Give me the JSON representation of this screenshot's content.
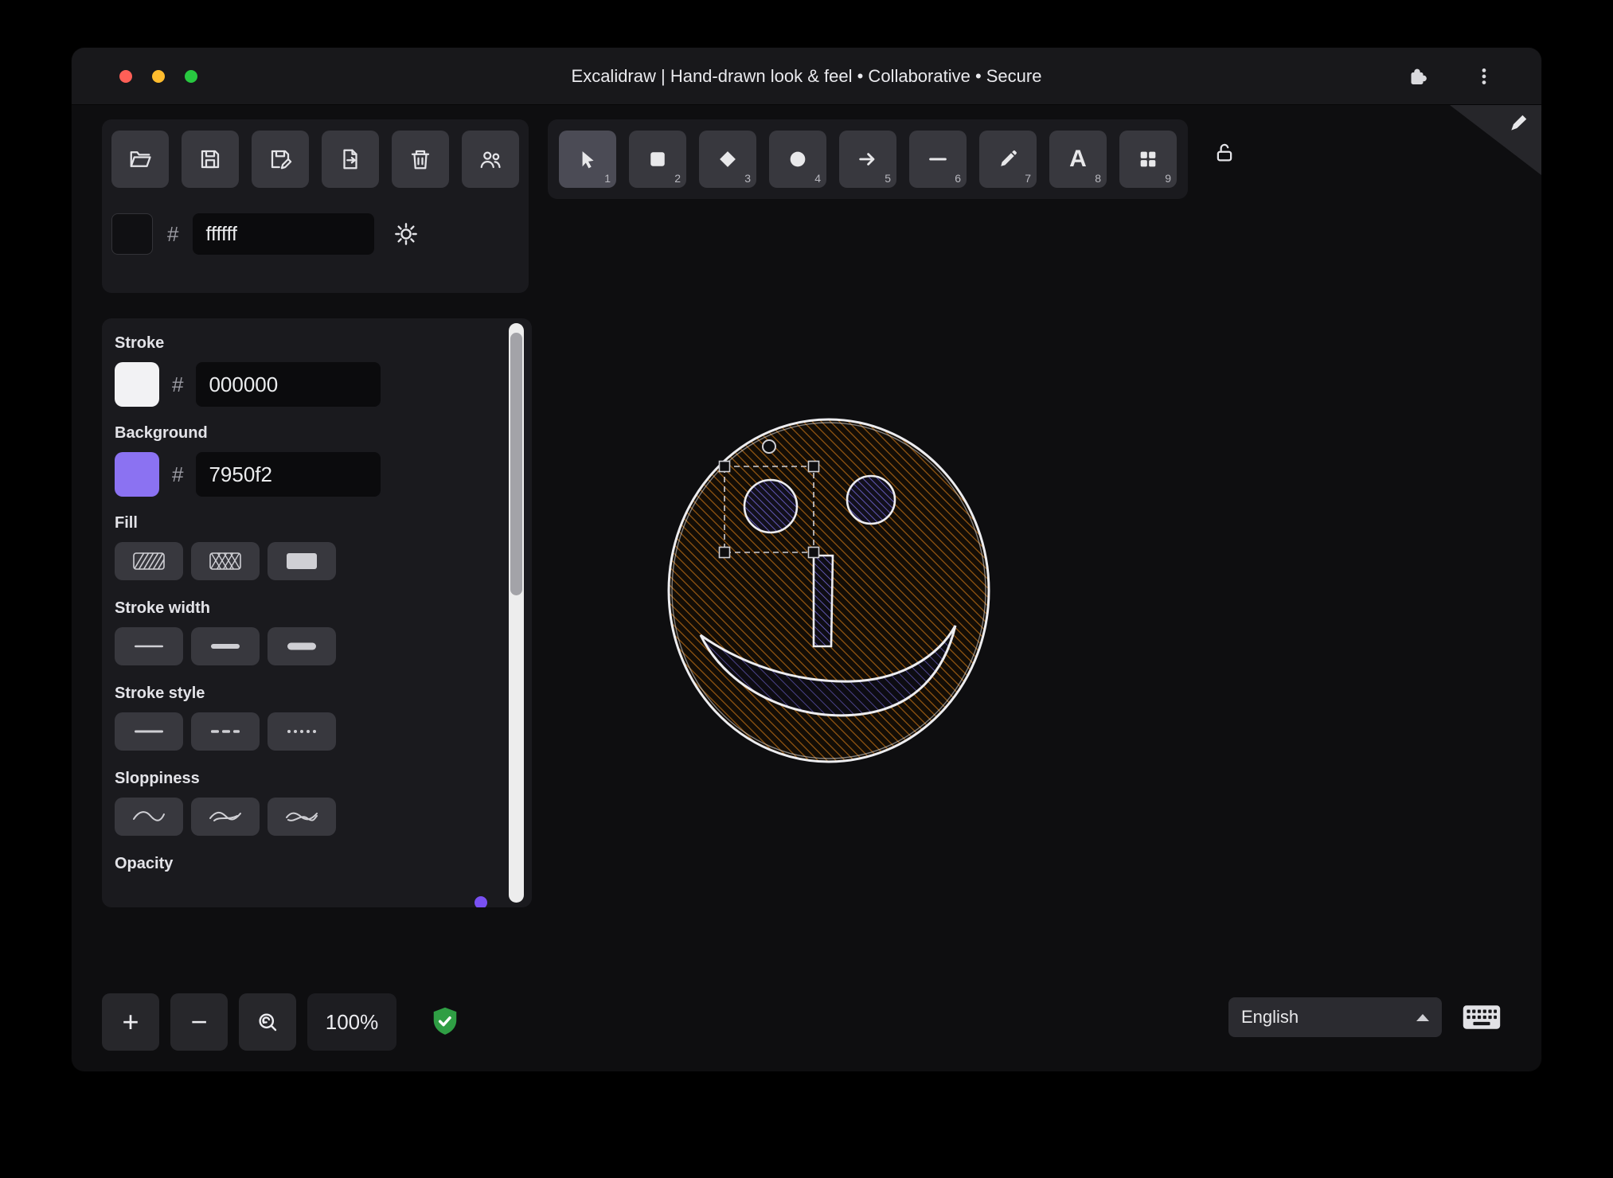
{
  "titlebar": {
    "title": "Excalidraw | Hand-drawn look & feel • Collaborative • Secure"
  },
  "file_toolbar": {
    "buttons": [
      {
        "name": "open-file"
      },
      {
        "name": "save-file"
      },
      {
        "name": "save-as"
      },
      {
        "name": "export-image"
      },
      {
        "name": "clear-canvas"
      },
      {
        "name": "live-collaboration"
      }
    ]
  },
  "canvas_background": {
    "hash": "#",
    "value": "ffffff"
  },
  "tools": [
    {
      "number": "1",
      "name": "selection"
    },
    {
      "number": "2",
      "name": "rectangle"
    },
    {
      "number": "3",
      "name": "diamond"
    },
    {
      "number": "4",
      "name": "ellipse"
    },
    {
      "number": "5",
      "name": "arrow"
    },
    {
      "number": "6",
      "name": "line"
    },
    {
      "number": "7",
      "name": "draw"
    },
    {
      "number": "8",
      "name": "text",
      "glyph": "A"
    },
    {
      "number": "9",
      "name": "shapes"
    }
  ],
  "properties": {
    "stroke": {
      "label": "Stroke",
      "hash": "#",
      "value": "000000",
      "swatch_color": "#f2f2f4"
    },
    "background": {
      "label": "Background",
      "hash": "#",
      "value": "7950f2",
      "swatch_color": "#8b72f2"
    },
    "fill": {
      "label": "Fill"
    },
    "stroke_width": {
      "label": "Stroke width"
    },
    "stroke_style": {
      "label": "Stroke style"
    },
    "sloppiness": {
      "label": "Sloppiness"
    },
    "opacity": {
      "label": "Opacity"
    }
  },
  "footer": {
    "zoom_in": "+",
    "zoom_out": "−",
    "zoom_level": "100%",
    "language": "English"
  },
  "colors": {
    "accent": "#7950f2",
    "shield_green": "#2f9e44",
    "face_hatch": "#9a5a12",
    "eye_hatch": "#6258b6"
  }
}
